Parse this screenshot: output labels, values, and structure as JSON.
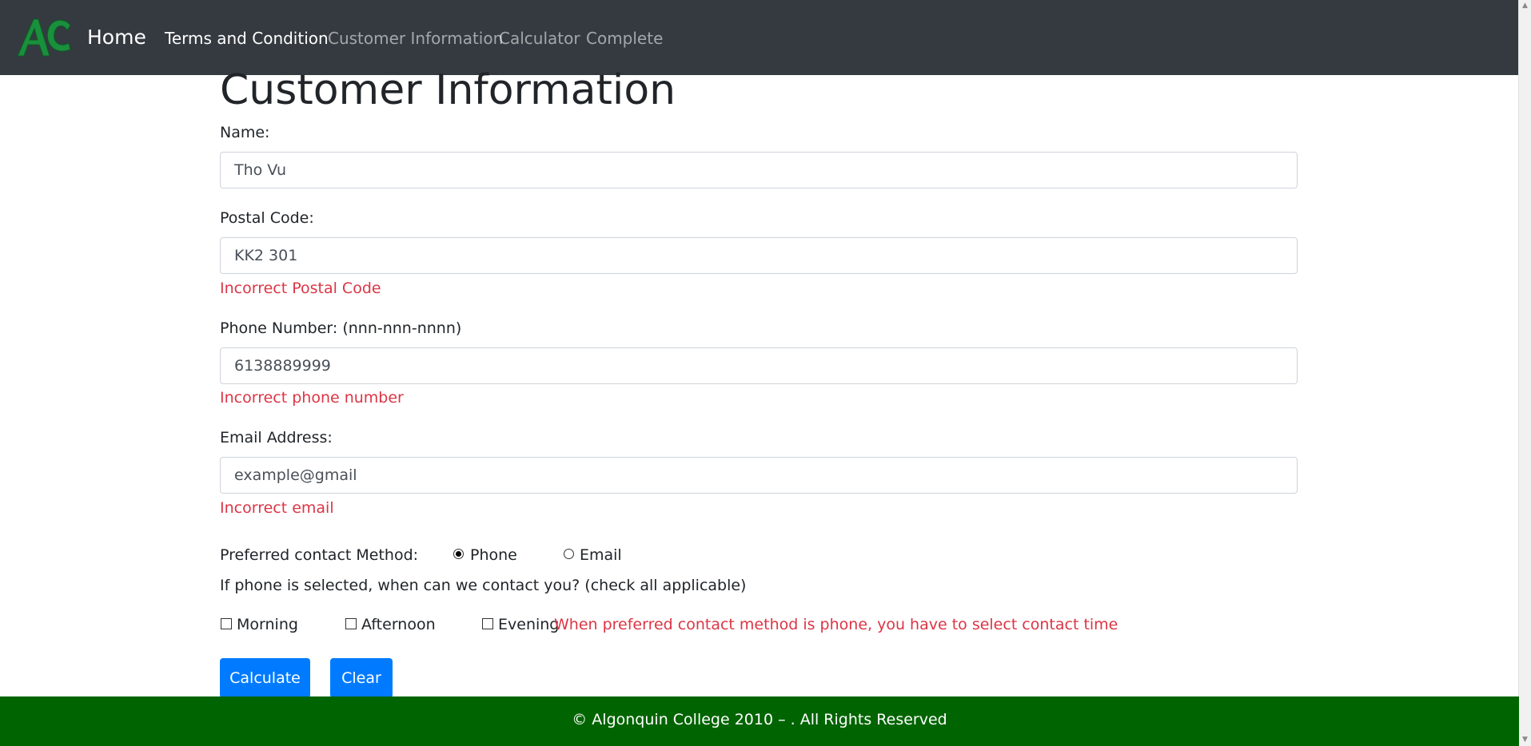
{
  "nav": {
    "brand": "Home",
    "links": [
      "Terms and Condition",
      "Customer Information",
      "Calculator",
      "Complete"
    ]
  },
  "page": {
    "title": "Customer Information"
  },
  "form": {
    "name": {
      "label": "Name:",
      "value": "Tho Vu"
    },
    "postal": {
      "label": "Postal Code:",
      "value": "KK2 301",
      "error": "Incorrect Postal Code"
    },
    "phone": {
      "label": "Phone Number: (nnn-nnn-nnnn)",
      "value": "6138889999",
      "error": "Incorrect phone number"
    },
    "email": {
      "label": "Email Address:",
      "value": "example@gmail",
      "error": "Incorrect email"
    },
    "contact_method": {
      "label": "Preferred contact Method:",
      "options": [
        "Phone",
        "Email"
      ],
      "selected": "Phone"
    },
    "contact_time": {
      "question": "If phone is selected, when can we contact you? (check all applicable)",
      "options": [
        "Morning",
        "Afternoon",
        "Evening"
      ],
      "error": "When preferred contact method is phone, you have to select contact time"
    },
    "buttons": {
      "calculate": "Calculate",
      "clear": "Clear"
    }
  },
  "footer": {
    "text": "© Algonquin College 2010 – . All Rights Reserved"
  },
  "colors": {
    "navbar": "#343a40",
    "primary": "#007bff",
    "error": "#dc3545",
    "footer": "#006400",
    "logo": "#1a8f3c"
  }
}
